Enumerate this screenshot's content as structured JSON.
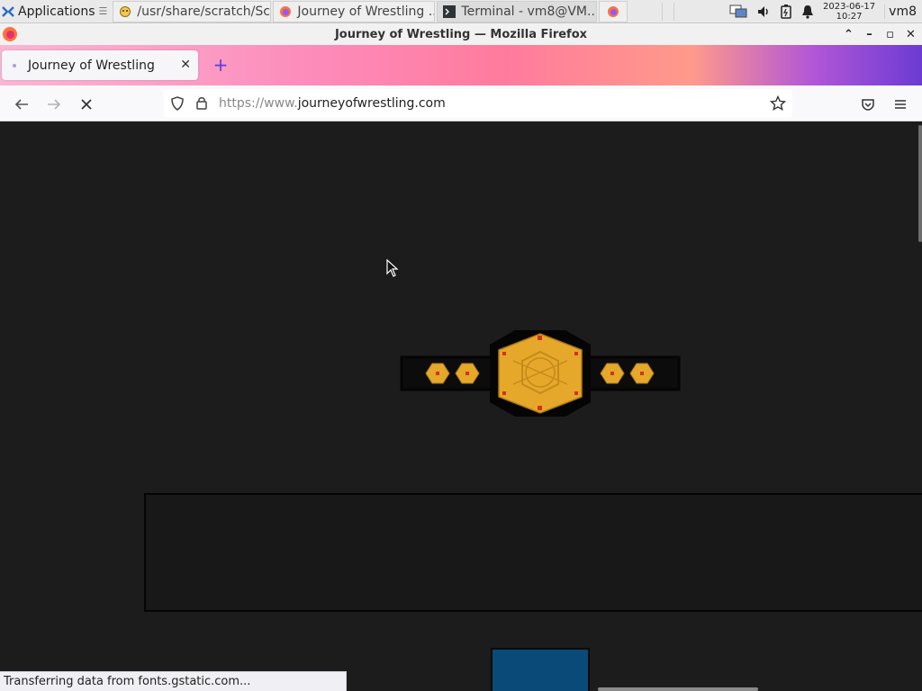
{
  "taskbar": {
    "applications_label": "Applications",
    "tasks": [
      {
        "label": "/usr/share/scratch/Sc...",
        "icon": "scratch-cat-icon"
      },
      {
        "label": "Journey of Wrestling ...",
        "icon": "firefox-icon"
      },
      {
        "label": "Terminal - vm8@VM...",
        "icon": "terminal-icon"
      }
    ],
    "clock_date": "2023-06-17",
    "clock_time": "10:27",
    "user": "vm8"
  },
  "window": {
    "title": "Journey of Wrestling — Mozilla Firefox"
  },
  "browser": {
    "tab_title": "Journey of Wrestling",
    "url_prefix": "https://www.",
    "url_host": "journeyofwrestling.com",
    "status_text": "Transferring data from fonts.gstatic.com..."
  },
  "colors": {
    "page_background": "#1c1c1c",
    "belt_gold": "#e5a82a",
    "belt_black": "#0c0c0c",
    "belt_jewel": "#d0341e",
    "blue_box": "#0a4a78"
  }
}
